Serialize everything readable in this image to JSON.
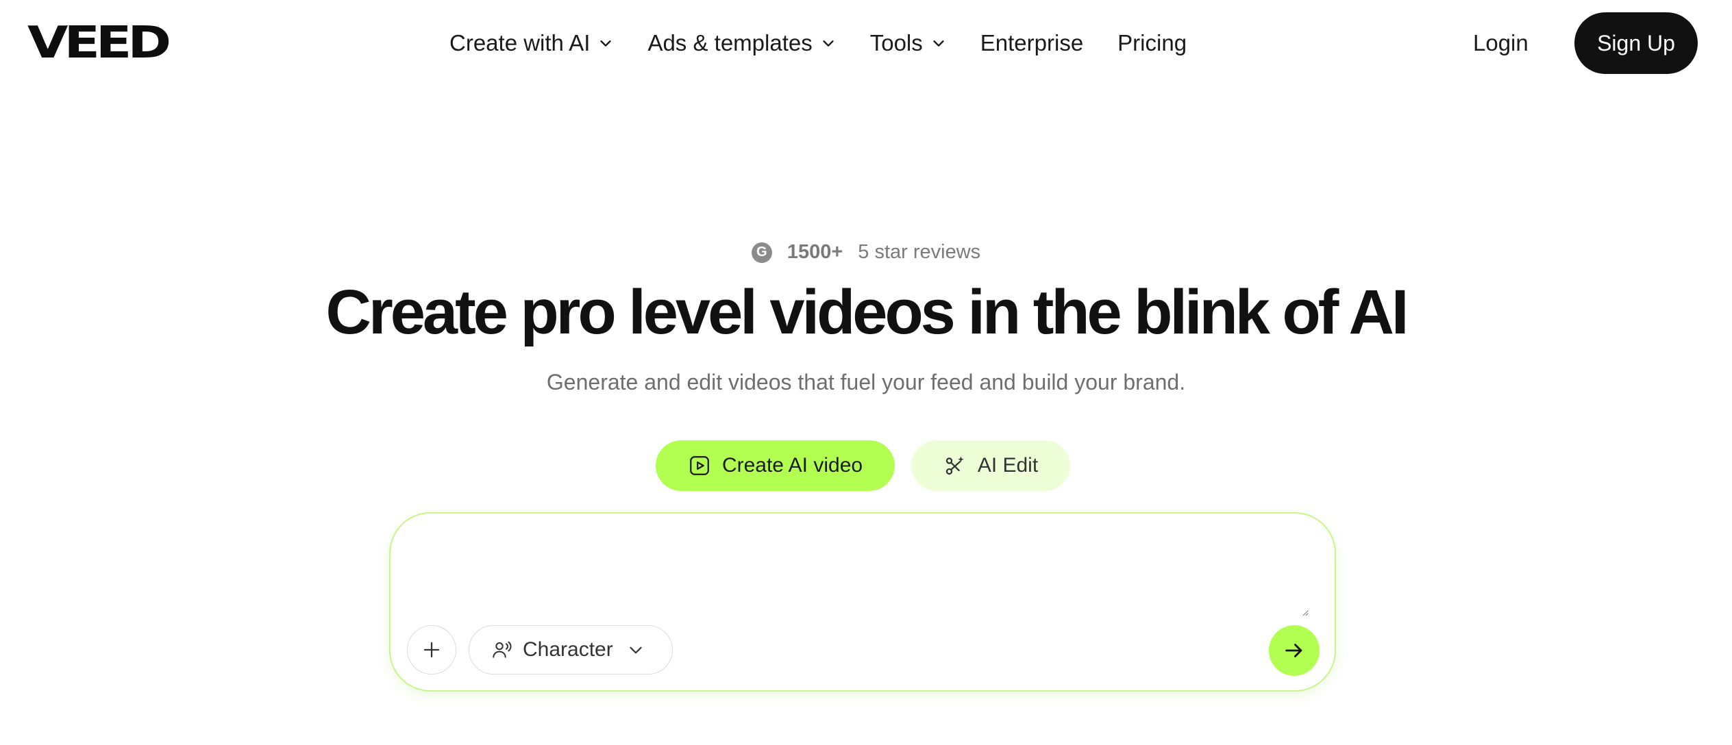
{
  "header": {
    "logo_text": "VEED",
    "nav": [
      {
        "label": "Create with AI",
        "has_dropdown": true
      },
      {
        "label": "Ads & templates",
        "has_dropdown": true
      },
      {
        "label": "Tools",
        "has_dropdown": true
      },
      {
        "label": "Enterprise",
        "has_dropdown": false
      },
      {
        "label": "Pricing",
        "has_dropdown": false
      }
    ],
    "login_label": "Login",
    "signup_label": "Sign Up"
  },
  "hero": {
    "reviews_icon": "g-icon",
    "reviews_icon_text": "G",
    "reviews_count": "1500+",
    "reviews_text": "5 star reviews",
    "headline": "Create pro level videos in the blink of AI",
    "subheadline": "Generate and edit videos that fuel your feed and build your brand.",
    "modes": [
      {
        "label": "Create AI video",
        "icon": "play-square-icon",
        "active": true
      },
      {
        "label": "AI Edit",
        "icon": "magic-scissors-icon",
        "active": false
      }
    ]
  },
  "prompt": {
    "value": "",
    "placeholder": "",
    "add_icon": "plus-icon",
    "character_label": "Character",
    "character_icon": "users-voice-icon",
    "send_icon": "arrow-right-icon"
  },
  "colors": {
    "accent": "#b2ff52",
    "accent_light": "#eeffd8",
    "dark": "#111111",
    "prompt_border": "#c9f58a"
  }
}
